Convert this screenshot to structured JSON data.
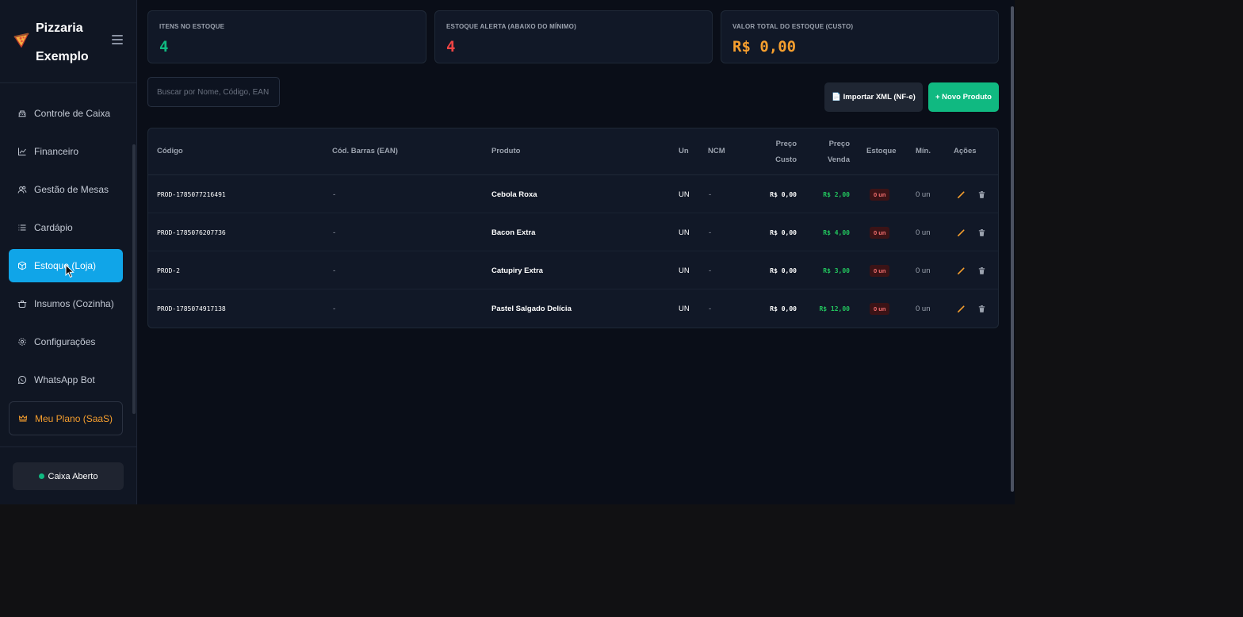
{
  "brand": {
    "name": "Pizzaria Exemplo",
    "logo_icon": "pizza-icon"
  },
  "sidebar": {
    "items": [
      {
        "label": "Controle de Caixa",
        "icon": "cash-register-icon"
      },
      {
        "label": "Financeiro",
        "icon": "chart-line-icon"
      },
      {
        "label": "Gestão de Mesas",
        "icon": "users-icon"
      },
      {
        "label": "Cardápio",
        "icon": "list-icon"
      },
      {
        "label": "Estoque (Loja)",
        "icon": "box-icon",
        "active": true
      },
      {
        "label": "Insumos (Cozinha)",
        "icon": "pot-icon"
      },
      {
        "label": "Configurações",
        "icon": "gear-icon"
      },
      {
        "label": "WhatsApp Bot",
        "icon": "whatsapp-icon"
      },
      {
        "label": "Meu Plano (SaaS)",
        "icon": "crown-icon"
      }
    ],
    "status": "Caixa Aberto"
  },
  "stats": [
    {
      "label": "ITENS NO ESTOQUE",
      "value": "4",
      "color": "#10b981"
    },
    {
      "label": "ESTOQUE ALERTA (ABAIXO DO MÍNIMO)",
      "value": "4",
      "color": "#ef4444"
    },
    {
      "label": "VALOR TOTAL DO ESTOQUE (CUSTO)",
      "value": "R$ 0,00",
      "color": "#f59e2e"
    }
  ],
  "search": {
    "placeholder": "Buscar por Nome, Código, EAN ou NCM..."
  },
  "actions": {
    "import_xml": "📄 Importar XML (NF-e)",
    "new_product": "+ Novo Produto"
  },
  "table": {
    "headers": {
      "codigo": "Código",
      "ean": "Cód. Barras (EAN)",
      "produto": "Produto",
      "un": "Un",
      "ncm": "NCM",
      "custo_1": "Preço",
      "custo_2": "Custo",
      "venda_1": "Preço",
      "venda_2": "Venda",
      "estoque": "Estoque",
      "min": "Mín.",
      "acoes": "Ações"
    },
    "rows": [
      {
        "codigo": "PROD-1785077216491",
        "ean": "-",
        "produto": "Cebola Roxa",
        "un": "UN",
        "ncm": "-",
        "custo": "R$ 0,00",
        "venda": "R$ 2,00",
        "estoque": "0 un",
        "min": "0 un"
      },
      {
        "codigo": "PROD-1785076207736",
        "ean": "-",
        "produto": "Bacon Extra",
        "un": "UN",
        "ncm": "-",
        "custo": "R$ 0,00",
        "venda": "R$ 4,00",
        "estoque": "0 un",
        "min": "0 un"
      },
      {
        "codigo": "PROD-2",
        "ean": "-",
        "produto": "Catupiry Extra",
        "un": "UN",
        "ncm": "-",
        "custo": "R$ 0,00",
        "venda": "R$ 3,00",
        "estoque": "0 un",
        "min": "0 un"
      },
      {
        "codigo": "PROD-1785074917138",
        "ean": "-",
        "produto": "Pastel Salgado Delícia",
        "un": "UN",
        "ncm": "-",
        "custo": "R$ 0,00",
        "venda": "R$ 12,00",
        "estoque": "0 un",
        "min": "0 un"
      }
    ]
  }
}
